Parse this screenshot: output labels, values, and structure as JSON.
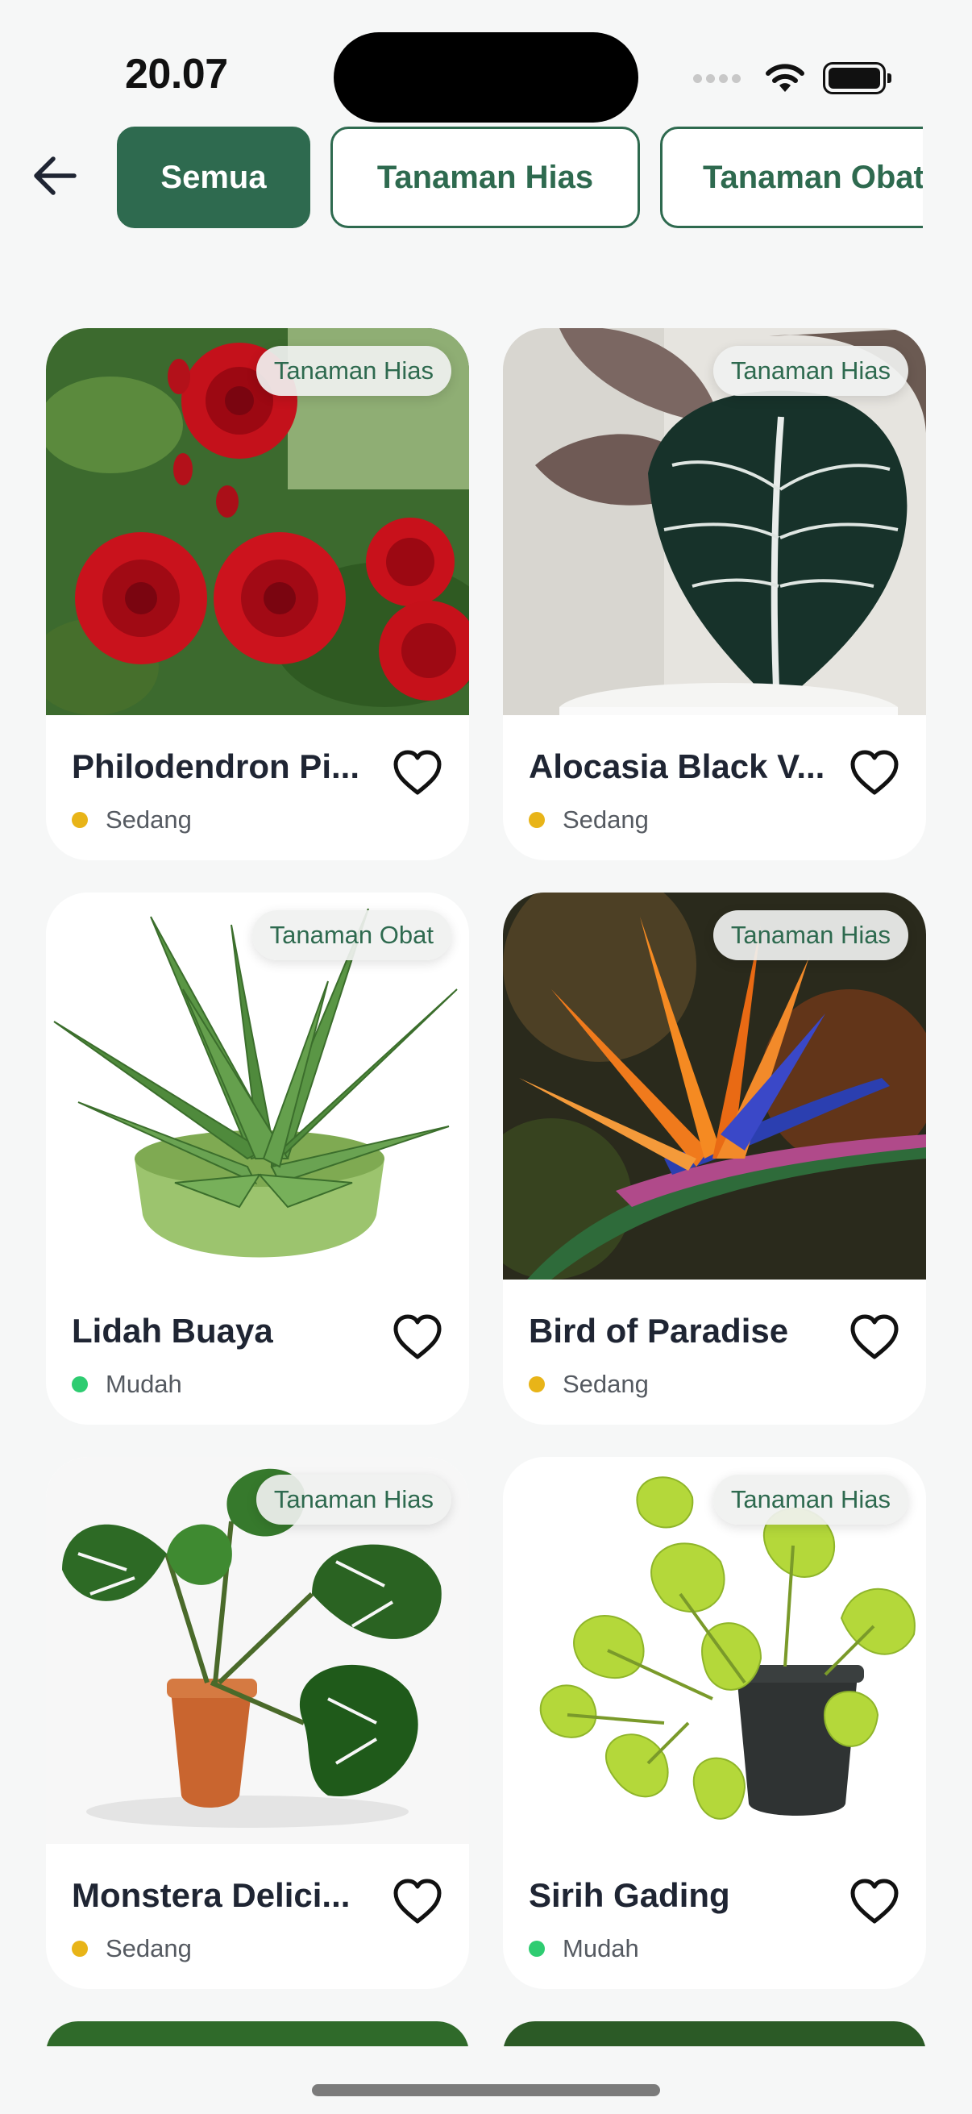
{
  "status_bar": {
    "time": "20.07"
  },
  "header": {
    "back_icon": "arrow-left-icon"
  },
  "filters": [
    {
      "label": "Semua",
      "active": true
    },
    {
      "label": "Tanaman Hias",
      "active": false
    },
    {
      "label": "Tanaman Obat",
      "active": false
    }
  ],
  "plants": [
    {
      "name": "Philodendron Pi...",
      "category": "Tanaman Hias",
      "difficulty": "Sedang",
      "difficulty_color": "#e8b418",
      "favorite": false
    },
    {
      "name": "Alocasia Black V...",
      "category": "Tanaman Hias",
      "difficulty": "Sedang",
      "difficulty_color": "#e8b418",
      "favorite": false
    },
    {
      "name": "Lidah Buaya",
      "category": "Tanaman Obat",
      "difficulty": "Mudah",
      "difficulty_color": "#2ecc71",
      "favorite": false
    },
    {
      "name": "Bird of Paradise",
      "category": "Tanaman Hias",
      "difficulty": "Sedang",
      "difficulty_color": "#e8b418",
      "favorite": false
    },
    {
      "name": "Monstera Delici...",
      "category": "Tanaman Hias",
      "difficulty": "Sedang",
      "difficulty_color": "#e8b418",
      "favorite": false
    },
    {
      "name": "Sirih Gading",
      "category": "Tanaman Hias",
      "difficulty": "Mudah",
      "difficulty_color": "#2ecc71",
      "favorite": false
    }
  ],
  "colors": {
    "primary": "#2e6a4f",
    "background": "#f6f7f7",
    "text": "#1f2533"
  }
}
